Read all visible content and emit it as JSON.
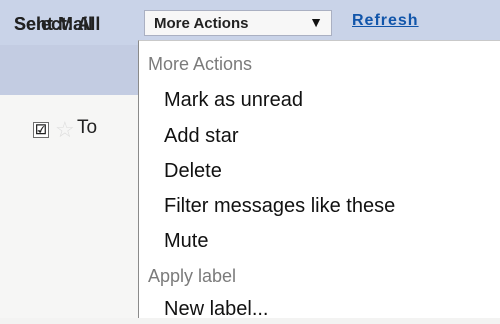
{
  "header": {
    "title": "Sent Mail",
    "more_actions_label": "More Actions",
    "dropdown_arrow": "▼",
    "refresh_label": "Refresh"
  },
  "select_bar": {
    "label": "Select: All"
  },
  "message_row": {
    "checkbox": "☑",
    "sender_partial": "To"
  },
  "menu": {
    "heading_more": "More Actions",
    "items": [
      "Mark as unread",
      "Add star",
      "Delete",
      "Filter messages like these",
      "Mute"
    ],
    "heading_label": "Apply label",
    "new_label": "New label..."
  }
}
